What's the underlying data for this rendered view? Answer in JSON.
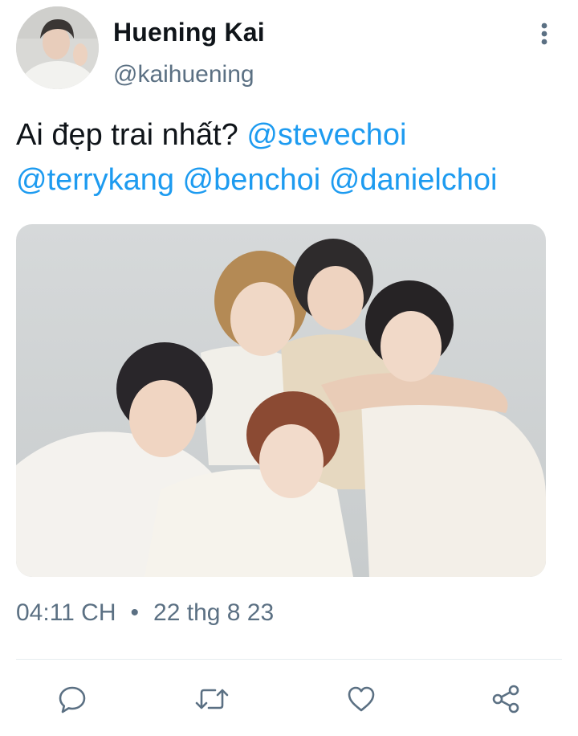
{
  "tweet": {
    "author": {
      "display_name": "Huening Kai",
      "handle": "@kaihuening"
    },
    "text": {
      "prefix": "Ai đẹp trai nhất? ",
      "mentions": [
        "@stevechoi",
        "@terrykang",
        "@benchoi",
        "@danielchoi"
      ]
    },
    "media": {
      "alt": "Group photo of five young men in light shirts against a grey backdrop"
    },
    "meta": {
      "time": "04:11 CH",
      "separator": "•",
      "date": "22 thg 8 23"
    }
  },
  "icons": {
    "more": "more-vertical-icon",
    "reply": "reply-icon",
    "retweet": "retweet-icon",
    "like": "heart-icon",
    "share": "share-icon"
  },
  "colors": {
    "link": "#1d9bf0",
    "secondary_text": "#5b7083",
    "primary_text": "#0f1419",
    "icon": "#5b7083"
  }
}
